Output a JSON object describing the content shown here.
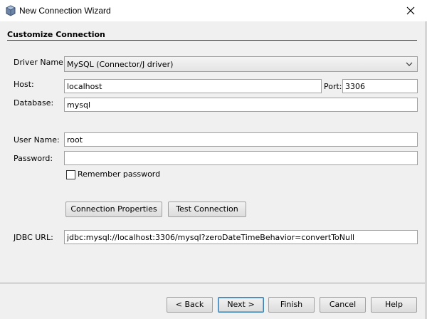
{
  "window": {
    "title": "New Connection Wizard",
    "icon": "database-icon",
    "close_icon": "close-icon"
  },
  "section": {
    "title": "Customize Connection"
  },
  "form": {
    "driver_label": "Driver Name:",
    "driver_value": "MySQL (Connector/J driver)",
    "host_label": "Host:",
    "host_value": "localhost",
    "port_label": "Port:",
    "port_value": "3306",
    "database_label": "Database:",
    "database_value": "mysql",
    "username_label": "User Name:",
    "username_value": "root",
    "password_label": "Password:",
    "password_value": "",
    "remember_label": "Remember password",
    "remember_checked": false,
    "conn_props_button": "Connection Properties",
    "test_conn_button": "Test Connection",
    "jdbc_label": "JDBC URL:",
    "jdbc_value": "jdbc:mysql://localhost:3306/mysql?zeroDateTimeBehavior=convertToNull"
  },
  "footer": {
    "back": "< Back",
    "next": "Next >",
    "finish": "Finish",
    "cancel": "Cancel",
    "help": "Help"
  }
}
